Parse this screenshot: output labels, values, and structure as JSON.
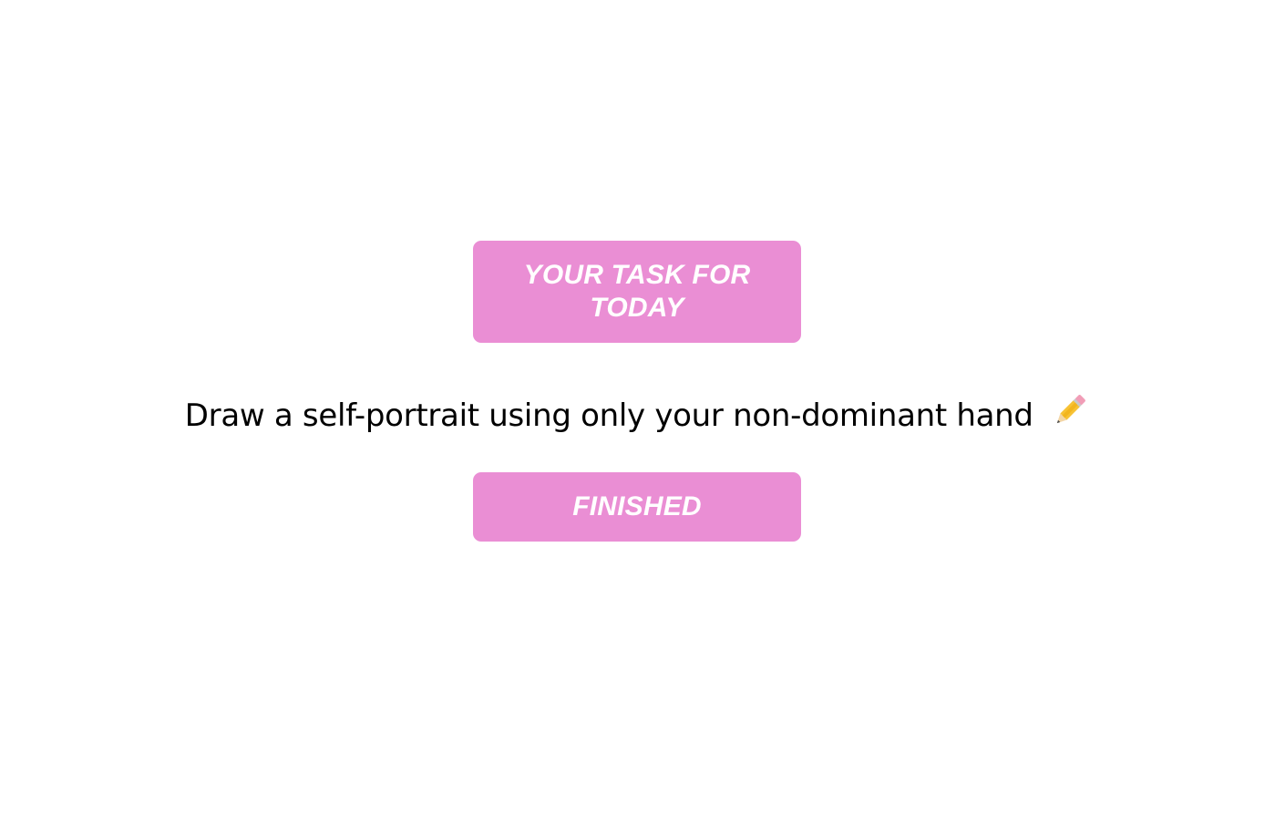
{
  "header": {
    "label": "YOUR TASK FOR TODAY"
  },
  "task": {
    "text": "Draw a self-portrait using only your non-dominant hand",
    "icon": "pencil-icon"
  },
  "actions": {
    "finished_label": "FINISHED"
  },
  "colors": {
    "accent": "#EA8ED4",
    "text": "#000000",
    "button_text": "#FFFFFF",
    "background": "#FFFFFF"
  }
}
